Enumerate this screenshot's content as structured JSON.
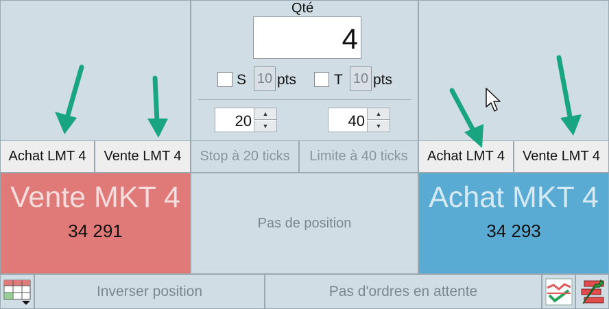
{
  "center": {
    "qty_label": "Qté",
    "qty_value": "4",
    "stop_checkbox_label": "S",
    "stop_points_value": "10",
    "stop_points_unit": "pts",
    "target_checkbox_label": "T",
    "target_points_value": "10",
    "target_points_unit": "pts",
    "stop_ticks_value": "20",
    "limit_ticks_value": "40",
    "position_status": "Pas de position"
  },
  "left": {
    "buy_lmt_label": "Achat LMT 4",
    "sell_lmt_label": "Vente LMT 4",
    "market_button_label": "Vente MKT 4",
    "market_price": "34 291"
  },
  "right": {
    "buy_lmt_label": "Achat LMT 4",
    "sell_lmt_label": "Vente LMT 4",
    "market_button_label": "Achat MKT 4",
    "market_price": "34 293"
  },
  "middle_bar": {
    "stop_button_label": "Stop à 20 ticks",
    "limit_button_label": "Limite à 40 ticks"
  },
  "bottom": {
    "reverse_position_label": "Inverser position",
    "pending_orders_label": "Pas d'ordres en attente"
  },
  "colors": {
    "sell_market": "#df7a78",
    "buy_market": "#5aabd3",
    "arrow": "#1aa581",
    "background": "#d0dde5"
  },
  "icons": [
    "grid-menu-icon",
    "chart-check-icon",
    "settings-wrench-icon",
    "mouse-cursor-icon",
    "arrow-annotation"
  ]
}
